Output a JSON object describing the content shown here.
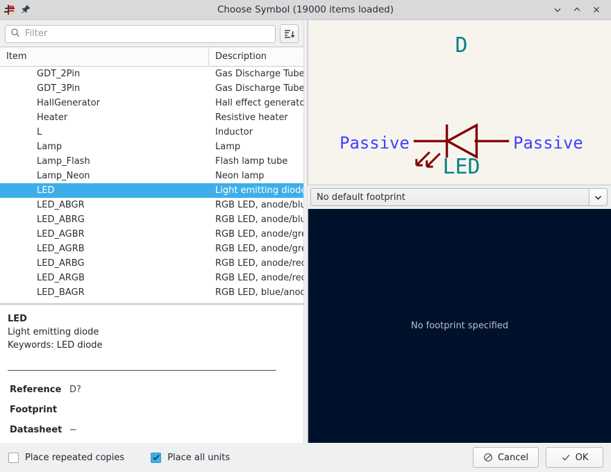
{
  "window": {
    "title": "Choose Symbol (19000 items loaded)",
    "app_icon": "kicad-eeschema-icon",
    "pin_icon": "pin-icon",
    "minimize_label": "⌄",
    "maximize_label": "⌃",
    "close_label": "✕"
  },
  "search": {
    "placeholder": "Filter",
    "value": "",
    "icon": "search-icon",
    "sort_icon": "sort-descending-icon"
  },
  "tree": {
    "columns": [
      "Item",
      "Description"
    ],
    "rows": [
      {
        "item": "GDT_2Pin",
        "desc": "Gas Discharge Tube w",
        "selected": false
      },
      {
        "item": "GDT_3Pin",
        "desc": "Gas Discharge Tube w",
        "selected": false
      },
      {
        "item": "HallGenerator",
        "desc": "Hall effect generator",
        "selected": false
      },
      {
        "item": "Heater",
        "desc": "Resistive heater",
        "selected": false
      },
      {
        "item": "L",
        "desc": "Inductor",
        "selected": false
      },
      {
        "item": "Lamp",
        "desc": "Lamp",
        "selected": false
      },
      {
        "item": "Lamp_Flash",
        "desc": "Flash lamp tube",
        "selected": false
      },
      {
        "item": "Lamp_Neon",
        "desc": "Neon lamp",
        "selected": false
      },
      {
        "item": "LED",
        "desc": "Light emitting diode",
        "selected": true
      },
      {
        "item": "LED_ABGR",
        "desc": "RGB LED, anode/blue",
        "selected": false
      },
      {
        "item": "LED_ABRG",
        "desc": "RGB LED, anode/blue",
        "selected": false
      },
      {
        "item": "LED_AGBR",
        "desc": "RGB LED, anode/gree",
        "selected": false
      },
      {
        "item": "LED_AGRB",
        "desc": "RGB LED, anode/gree",
        "selected": false
      },
      {
        "item": "LED_ARBG",
        "desc": "RGB LED, anode/red/",
        "selected": false
      },
      {
        "item": "LED_ARGB",
        "desc": "RGB LED, anode/red/",
        "selected": false
      },
      {
        "item": "LED_BAGR",
        "desc": "RGB LED, blue/anode",
        "selected": false
      }
    ]
  },
  "details": {
    "name": "LED",
    "description": "Light emitting diode",
    "keywords": "Keywords: LED diode",
    "fields": [
      {
        "key": "Reference",
        "value": "D?"
      },
      {
        "key": "Footprint",
        "value": ""
      },
      {
        "key": "Datasheet",
        "value": "~"
      }
    ]
  },
  "symbol_preview": {
    "reference_label": "D",
    "value_label": "LED",
    "pin_left_label": "Passive",
    "pin_right_label": "Passive",
    "background_color": "#f7f4ee",
    "body_color": "#840000",
    "text_color": "#008484",
    "pin_text_color": "#4040ff"
  },
  "footprint": {
    "selected": "No default footprint",
    "dropdown_icon": "chevron-down-icon",
    "preview_message": "No footprint specified",
    "preview_background": "#00112b"
  },
  "bottom": {
    "place_repeated_copies": {
      "label": "Place repeated copies",
      "checked": false
    },
    "place_all_units": {
      "label": "Place all units",
      "checked": true
    },
    "cancel_label": "Cancel",
    "ok_label": "OK",
    "cancel_icon": "cancel-circle-icon",
    "ok_icon": "check-icon"
  }
}
